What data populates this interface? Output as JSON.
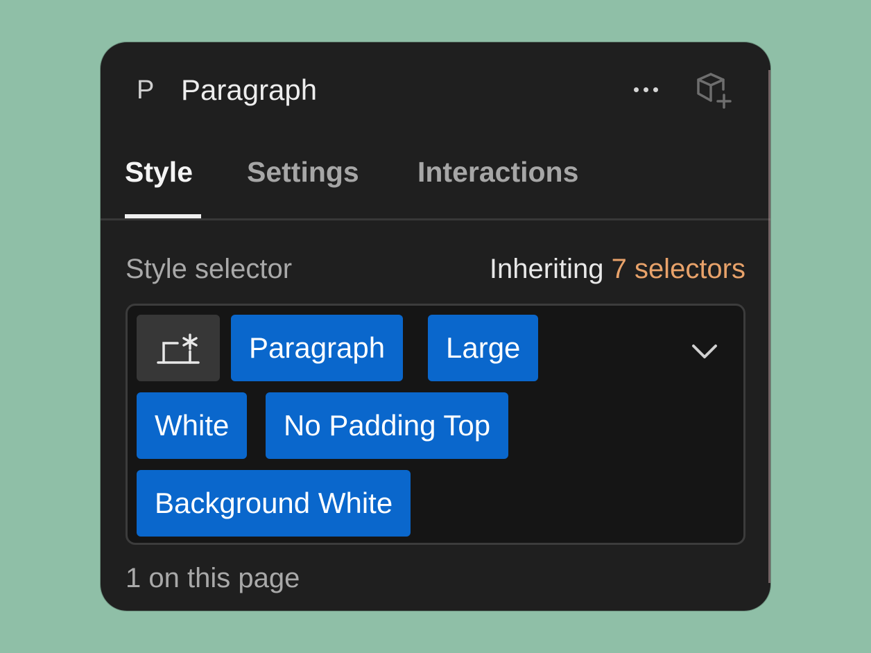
{
  "header": {
    "element_letter": "P",
    "element_name": "Paragraph",
    "more_icon": "more-horizontal-icon",
    "component_icon": "create-component-icon"
  },
  "tabs": [
    {
      "label": "Style",
      "active": true
    },
    {
      "label": "Settings",
      "active": false
    },
    {
      "label": "Interactions",
      "active": false
    }
  ],
  "style_selector": {
    "label": "Style selector",
    "inheriting_prefix": "Inheriting",
    "inheriting_link": "7 selectors",
    "state_icon": "element-state-icon",
    "chips": [
      "Paragraph",
      "Large",
      "White",
      "No Padding Top",
      "Background White"
    ],
    "dropdown_icon": "chevron-down-icon",
    "usage": "1 on this page"
  },
  "colors": {
    "background": "#8fbfa7",
    "panel": "#1f1f1f",
    "chip": "#0a67cc",
    "link": "#e8a26a"
  }
}
